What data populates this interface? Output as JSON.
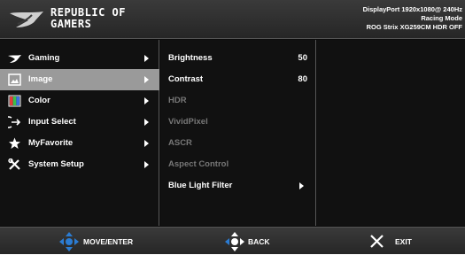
{
  "header": {
    "brand_line1": "REPUBLIC OF",
    "brand_line2": "GAMERS",
    "info_line1": "DisplayPort 1920x1080@ 240Hz",
    "info_line2": "Racing Mode",
    "info_line3": "ROG Strix XG259CM HDR OFF"
  },
  "menu": [
    {
      "label": "Gaming",
      "icon": "rog-eye-icon",
      "selected": false
    },
    {
      "label": "Image",
      "icon": "image-icon",
      "selected": true
    },
    {
      "label": "Color",
      "icon": "color-icon",
      "selected": false
    },
    {
      "label": "Input Select",
      "icon": "input-select-icon",
      "selected": false
    },
    {
      "label": "MyFavorite",
      "icon": "star-icon",
      "selected": false
    },
    {
      "label": "System Setup",
      "icon": "tools-icon",
      "selected": false
    }
  ],
  "submenu": [
    {
      "label": "Brightness",
      "value": "50",
      "enabled": true
    },
    {
      "label": "Contrast",
      "value": "80",
      "enabled": true
    },
    {
      "label": "HDR",
      "value": "",
      "enabled": false
    },
    {
      "label": "VividPixel",
      "value": "",
      "enabled": false
    },
    {
      "label": "ASCR",
      "value": "",
      "enabled": false
    },
    {
      "label": "Aspect Control",
      "value": "",
      "enabled": false
    },
    {
      "label": "Blue Light Filter",
      "value": "",
      "enabled": true,
      "has_submenu": true
    }
  ],
  "footer": {
    "move_label": "MOVE/ENTER",
    "back_label": "BACK",
    "exit_label": "EXIT"
  },
  "colors": {
    "accent_blue": "#2b7cd3",
    "selected_bg": "#9a9a9a",
    "disabled_text": "#777777"
  }
}
